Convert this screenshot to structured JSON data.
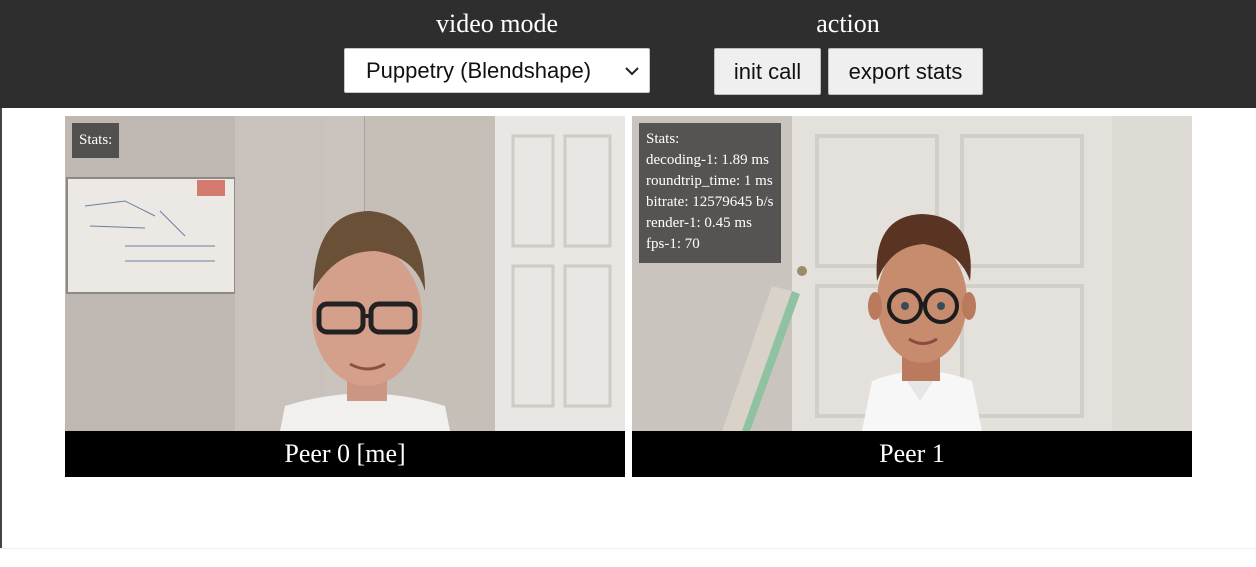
{
  "header": {
    "video_mode_label": "video mode",
    "action_label": "action",
    "video_mode_select": {
      "selected": "Puppetry (Blendshape)"
    },
    "buttons": {
      "init_call": "init call",
      "export_stats": "export stats"
    }
  },
  "peers": [
    {
      "caption": "Peer 0 [me]",
      "stats_title": "Stats:"
    },
    {
      "caption": "Peer 1",
      "stats_title": "Stats:",
      "stats_lines": [
        "decoding-1: 1.89 ms",
        "roundtrip_time: 1 ms",
        "bitrate: 12579645 b/s",
        "render-1: 0.45 ms",
        "fps-1: 70"
      ]
    }
  ],
  "colors": {
    "toolbar_bg": "#2e2e2e",
    "caption_bg": "#000000",
    "button_bg": "#efefef"
  },
  "icons": {
    "select_arrow": "chevron-down-icon"
  }
}
